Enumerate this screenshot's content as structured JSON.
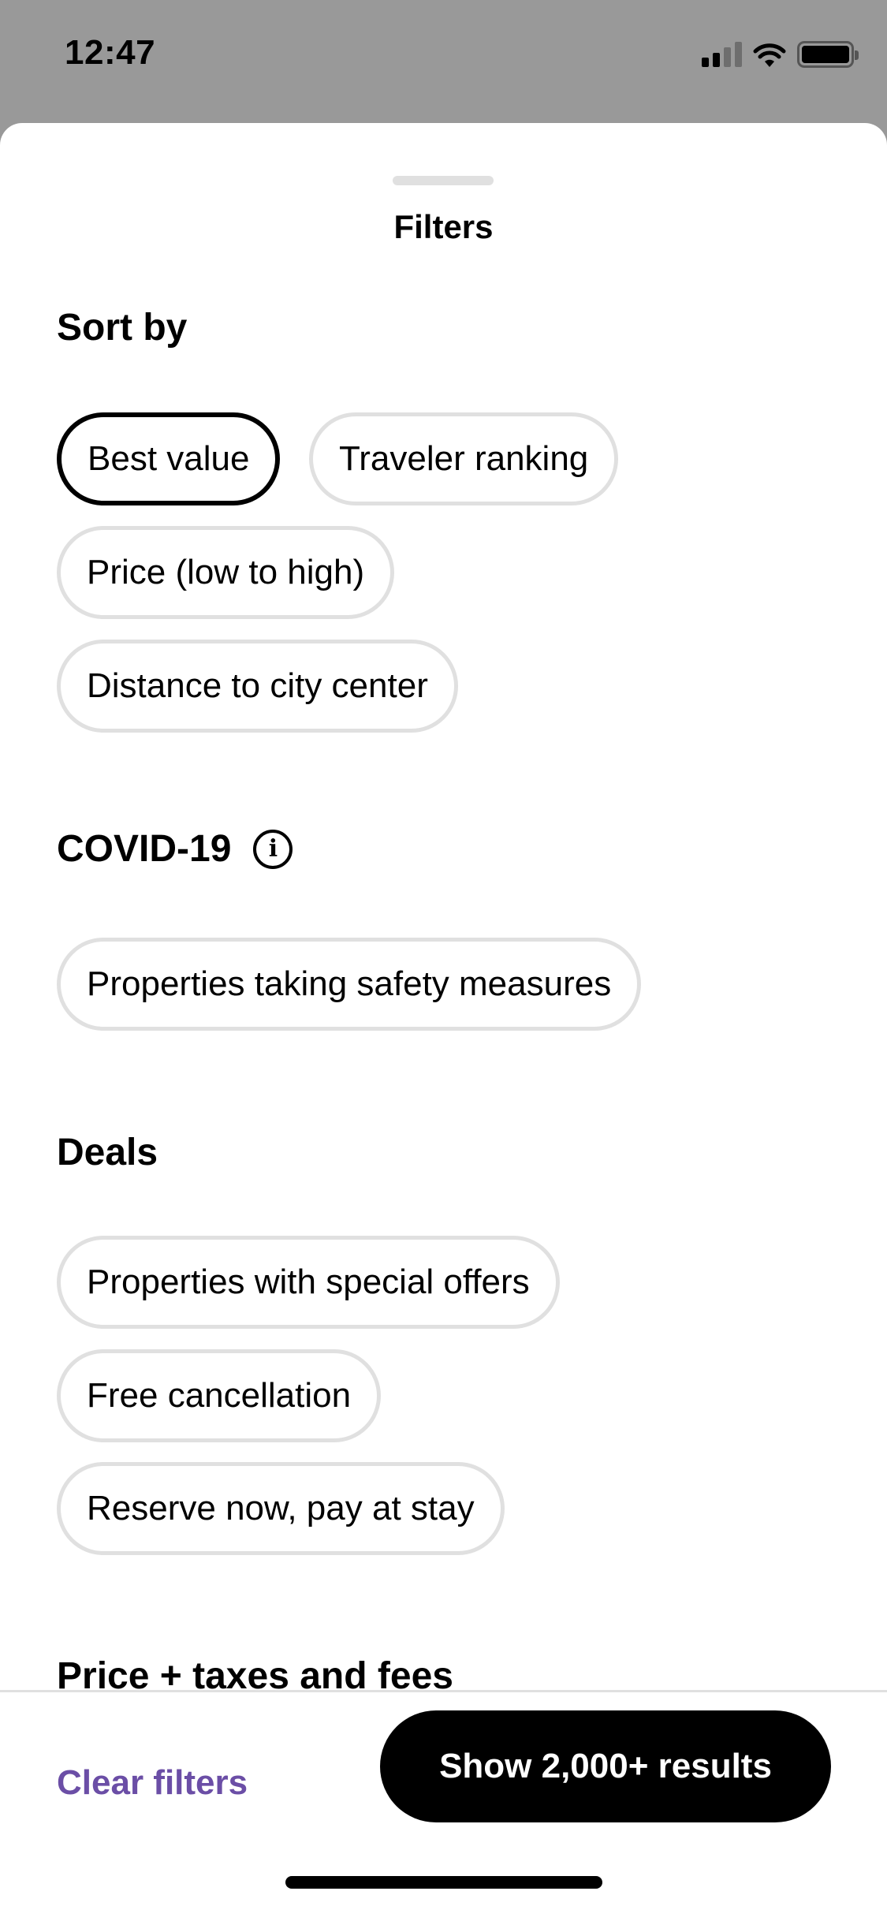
{
  "status_bar": {
    "time": "12:47",
    "icons": [
      "cellular-signal-icon",
      "wifi-icon",
      "battery-icon"
    ]
  },
  "sheet": {
    "title": "Filters"
  },
  "sections": {
    "sort_by": {
      "title": "Sort by",
      "options": [
        {
          "label": "Best value",
          "selected": true
        },
        {
          "label": "Traveler ranking",
          "selected": false
        },
        {
          "label": "Price (low to high)",
          "selected": false
        },
        {
          "label": "Distance to city center",
          "selected": false
        }
      ]
    },
    "covid": {
      "title": "COVID-19",
      "info_icon": "info-icon",
      "info_glyph": "i",
      "options": [
        {
          "label": "Properties taking safety measures",
          "selected": false
        }
      ]
    },
    "deals": {
      "title": "Deals",
      "options": [
        {
          "label": "Properties with special offers",
          "selected": false
        },
        {
          "label": "Free cancellation",
          "selected": false
        },
        {
          "label": "Reserve now, pay at stay",
          "selected": false
        }
      ]
    },
    "price": {
      "title": "Price + taxes and fees"
    }
  },
  "footer": {
    "clear_label": "Clear filters",
    "show_results_label": "Show 2,000+ results"
  },
  "colors": {
    "accent": "#6b4ea6",
    "primary_button": "#000000",
    "chip_border": "#e0e0e0",
    "backdrop": "#999999"
  }
}
